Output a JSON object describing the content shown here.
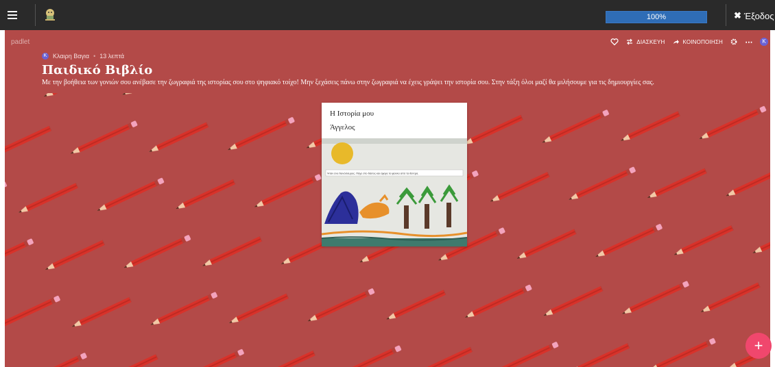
{
  "toolbar": {
    "menu_icon": "hamburger-icon",
    "app_logo_icon": "app-logo-icon",
    "progress_value": 1.0,
    "progress_label": "100%",
    "exit_label": "Έξοδος",
    "exit_icon": "close-icon"
  },
  "board": {
    "brand": "padlet",
    "author_initial": "Κ",
    "author_name": "Κλαιρη Βαγια",
    "time_ago": "13 λεπτά",
    "title": "Παιδικό Βιβλίο",
    "description": "Με την βοήθεια των γονιών σου ανέβασε την ζωγραφιά της ιστορίας σου στο ψηφιακό τοίχο! Μην ξεχάσεις πάνω στην ζωγραφιά να έχεις γράψει την ιστορία σου. Στην τάξη όλοι μαζί θα μιλήσουμε για τις δημιουργίες σας.",
    "background_color": "#b34a48",
    "actions": {
      "like_icon": "heart-icon",
      "remake_label": "ΔΙΑΣΚΕΥΗ",
      "remake_icon": "remake-icon",
      "share_label": "ΚΟΙΝΟΠΟΙΗΣΗ",
      "share_icon": "share-arrow-icon",
      "settings_icon": "gear-icon",
      "more_icon": "more-icon",
      "user_initial": "Κ"
    }
  },
  "post": {
    "title": "Η Ιστορία μου",
    "body": "Άγγελος",
    "image_caption": "Ήταν ένα δεινόσαυρος. Πήγε στο δάσος και έφαγε τα φύλλα από τα δέντρα."
  },
  "fab": {
    "label": "+",
    "icon": "plus-icon",
    "color": "#f0476d"
  }
}
